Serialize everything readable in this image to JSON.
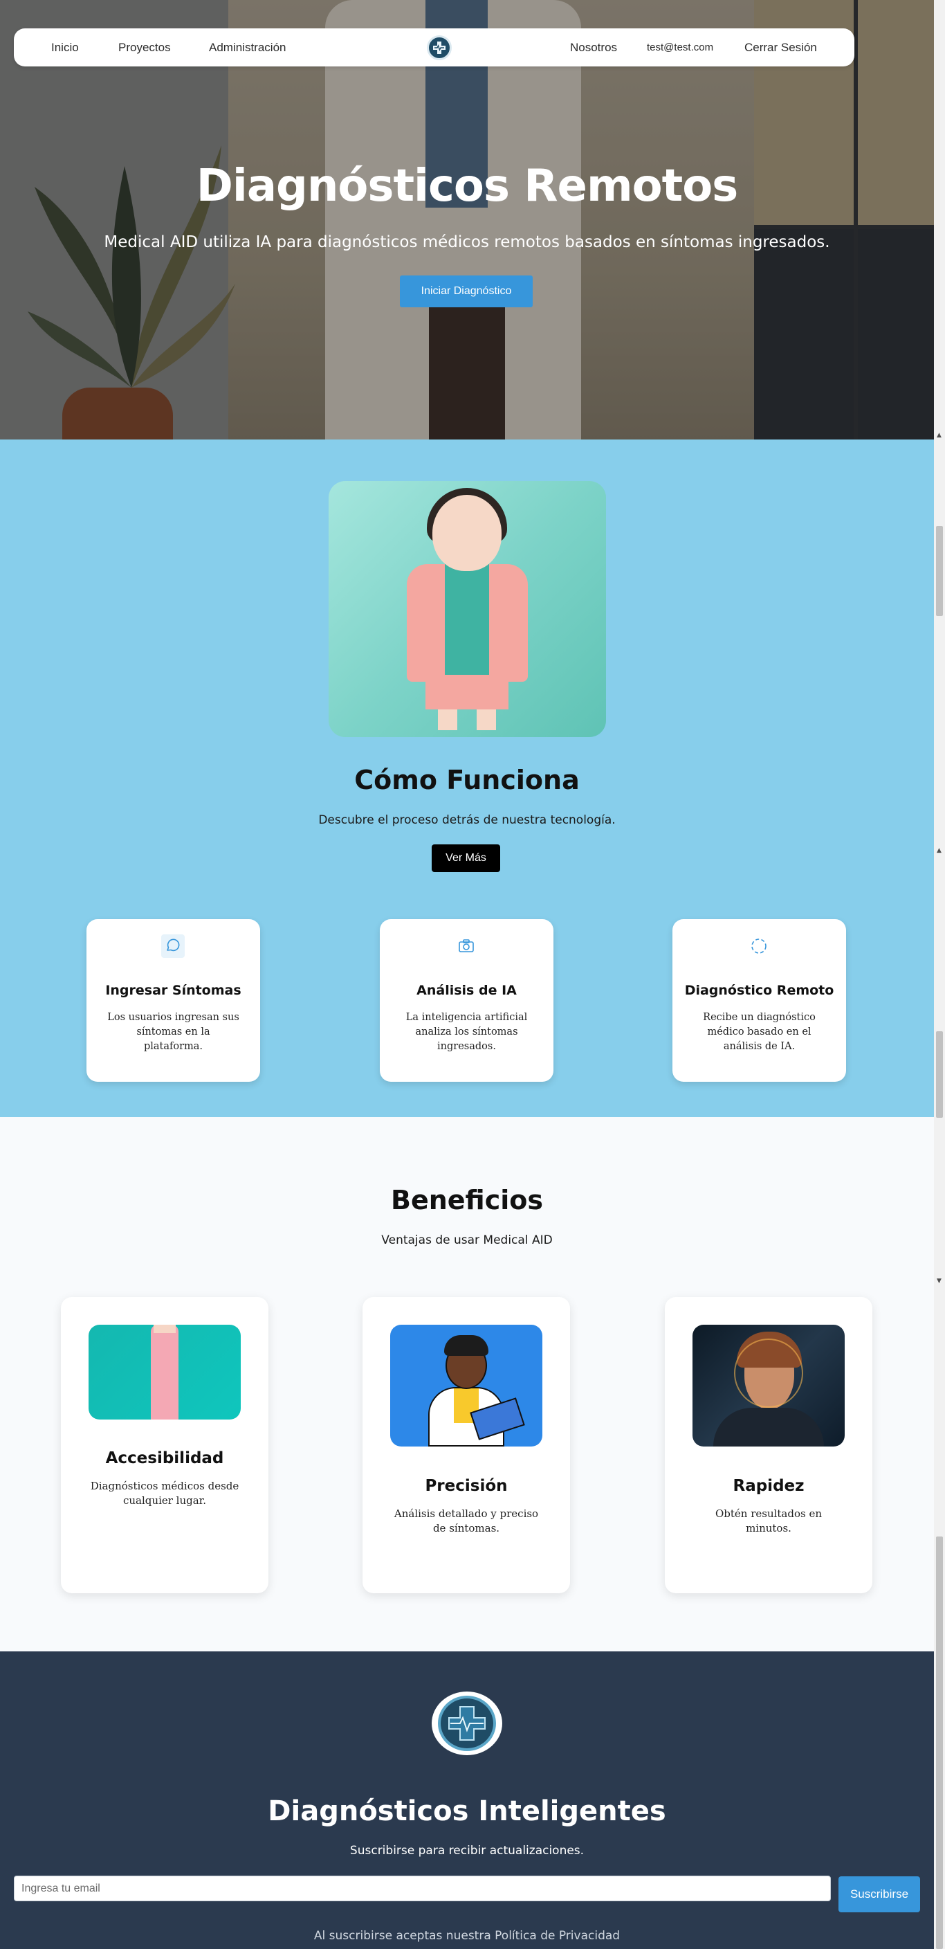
{
  "navbar": {
    "items_left": [
      "Inicio",
      "Proyectos",
      "Administración"
    ],
    "logo": "medical-cross-logo",
    "items_right": [
      "Nosotros",
      "test@test.com",
      "Cerrar Sesión"
    ]
  },
  "hero": {
    "title": "Diagnósticos Remotos",
    "subtitle": "Medical AID utiliza IA para diagnósticos médicos remotos basados en síntomas ingresados.",
    "cta": "Iniciar Diagnóstico"
  },
  "how": {
    "title": "Cómo Funciona",
    "subtitle": "Descubre el proceso detrás de nuestra tecnología.",
    "cta": "Ver Más",
    "steps": [
      {
        "icon": "chat-bubble-icon",
        "title": "Ingresar Síntomas",
        "desc": "Los usuarios ingresan sus síntomas en la plataforma."
      },
      {
        "icon": "camera-icon",
        "title": "Análisis de IA",
        "desc": "La inteligencia artificial analiza los síntomas ingresados."
      },
      {
        "icon": "loader-icon",
        "title": "Diagnóstico Remoto",
        "desc": "Recibe un diagnóstico médico basado en el análisis de IA."
      }
    ]
  },
  "benefits": {
    "title": "Beneficios",
    "subtitle": "Ventajas de usar Medical AID",
    "cards": [
      {
        "title": "Accesibilidad",
        "desc": "Diagnósticos médicos desde cualquier lugar."
      },
      {
        "title": "Precisión",
        "desc": "Análisis detallado y preciso de síntomas."
      },
      {
        "title": "Rapidez",
        "desc": "Obtén resultados en minutos."
      }
    ]
  },
  "footer": {
    "title": "Diagnósticos Inteligentes",
    "subtitle": "Suscribirse para recibir actualizaciones.",
    "email_placeholder": "Ingresa tu email",
    "email_value": "",
    "subscribe": "Suscribirse",
    "legal": "Al suscribirse aceptas nuestra Política de Privacidad"
  },
  "colors": {
    "accent_blue": "#3796db",
    "how_bg": "#87ceeb",
    "footer_bg": "#2b3a4f",
    "page_bg": "#f8fafc"
  }
}
